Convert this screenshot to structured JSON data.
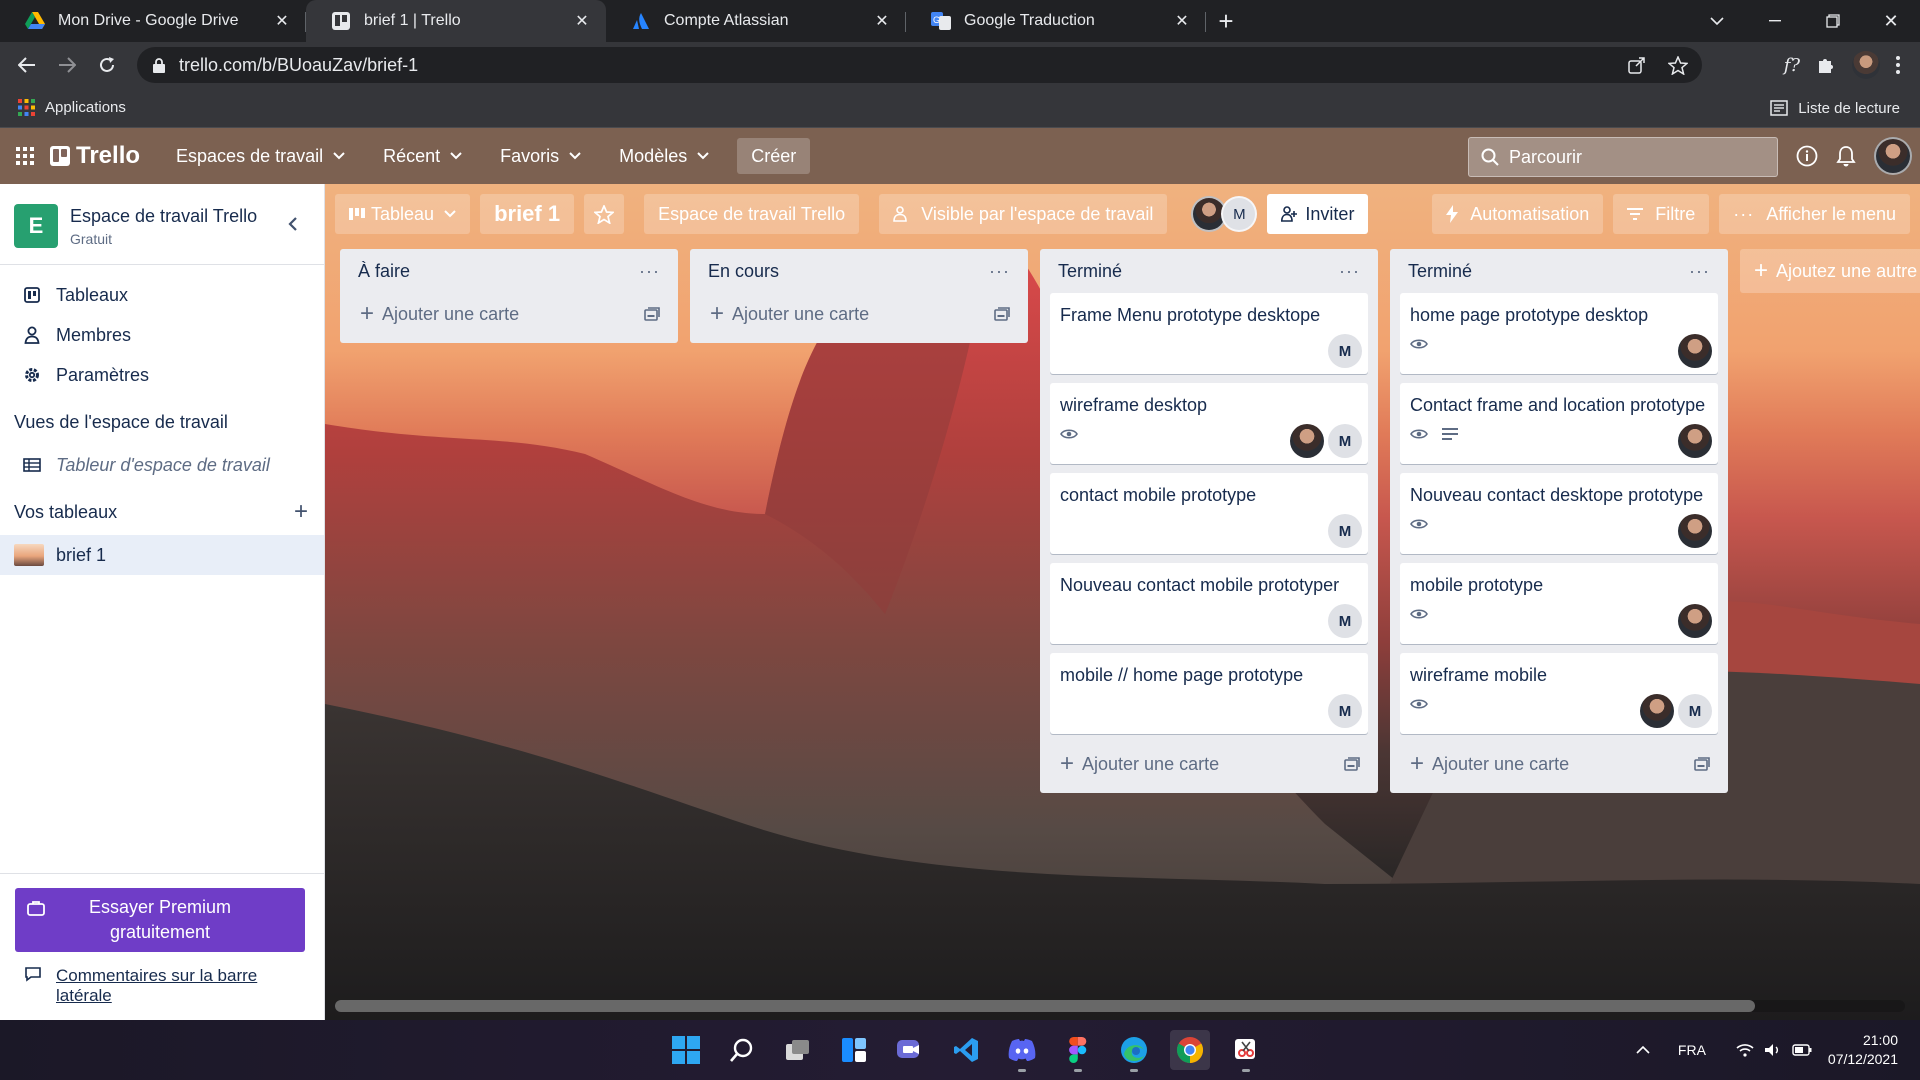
{
  "browser": {
    "tabs": [
      {
        "title": "Mon Drive - Google Drive",
        "icon": "google-drive-icon",
        "active": false
      },
      {
        "title": "brief 1 | Trello",
        "icon": "trello-icon",
        "active": true
      },
      {
        "title": "Compte Atlassian",
        "icon": "atlassian-icon",
        "active": false
      },
      {
        "title": "Google Traduction",
        "icon": "google-translate-icon",
        "active": false
      }
    ],
    "url": "trello.com/b/BUoauZav/brief-1",
    "bookmarks": {
      "apps": "Applications",
      "reading_list": "Liste de lecture"
    }
  },
  "header": {
    "logo": "Trello",
    "nav": [
      {
        "label": "Espaces de travail"
      },
      {
        "label": "Récent"
      },
      {
        "label": "Favoris"
      },
      {
        "label": "Modèles"
      }
    ],
    "create": "Créer",
    "search_placeholder": "Parcourir"
  },
  "sidebar": {
    "workspace_initial": "E",
    "workspace_name": "Espace de travail Trello",
    "workspace_plan": "Gratuit",
    "items": [
      {
        "label": "Tableaux",
        "icon": "board-icon"
      },
      {
        "label": "Membres",
        "icon": "person-icon"
      },
      {
        "label": "Paramètres",
        "icon": "gear-icon"
      }
    ],
    "views_heading": "Vues de l'espace de travail",
    "views_item": "Tableur d'espace de travail",
    "boards_heading": "Vos tableaux",
    "boards": [
      {
        "label": "brief 1"
      }
    ],
    "premium": "Essayer Premium gratuitement",
    "feedback": "Commentaires sur la barre latérale"
  },
  "boardbar": {
    "view": "Tableau",
    "name": "brief 1",
    "workspace": "Espace de travail Trello",
    "visibility": "Visible par l'espace de travail",
    "member_initial": "M",
    "invite": "Inviter",
    "automation": "Automatisation",
    "filter": "Filtre",
    "menu": "Afficher le menu"
  },
  "lists": [
    {
      "title": "À faire",
      "add": "Ajouter une carte",
      "cards": []
    },
    {
      "title": "En cours",
      "add": "Ajouter une carte",
      "cards": []
    },
    {
      "title": "Terminé",
      "add": "Ajouter une carte",
      "cards": [
        {
          "title": "Frame Menu prototype desktope",
          "badges": [],
          "members": [
            "M"
          ]
        },
        {
          "title": "wireframe desktop",
          "badges": [
            "eye-icon"
          ],
          "members": [
            "photo",
            "M"
          ]
        },
        {
          "title": "contact mobile prototype",
          "badges": [],
          "members": [
            "M"
          ]
        },
        {
          "title": "Nouveau contact mobile prototyper",
          "badges": [],
          "members": [
            "M"
          ]
        },
        {
          "title": "mobile // home page prototype",
          "badges": [],
          "members": [
            "M"
          ]
        }
      ]
    },
    {
      "title": "Terminé",
      "add": "Ajouter une carte",
      "cards": [
        {
          "title": "home page prototype desktop",
          "badges": [
            "eye-icon"
          ],
          "members": [
            "photo"
          ]
        },
        {
          "title": "Contact frame and location prototype",
          "badges": [
            "eye-icon",
            "description-icon"
          ],
          "members": [
            "photo"
          ]
        },
        {
          "title": "Nouveau contact desktope prototype",
          "badges": [
            "eye-icon"
          ],
          "members": [
            "photo"
          ]
        },
        {
          "title": "mobile prototype",
          "badges": [
            "eye-icon"
          ],
          "members": [
            "photo"
          ]
        },
        {
          "title": "wireframe mobile",
          "badges": [
            "eye-icon"
          ],
          "members": [
            "photo",
            "M"
          ]
        }
      ]
    }
  ],
  "add_list": "Ajoutez une autre liste",
  "taskbar": {
    "apps": [
      "windows-start-icon",
      "search-icon",
      "task-view-icon",
      "widgets-icon",
      "teams-chat-icon",
      "vscode-icon",
      "discord-icon",
      "figma-icon",
      "edge-icon",
      "chrome-icon",
      "snipping-tool-icon"
    ],
    "language": "FRA",
    "time": "21:00",
    "date": "07/12/2021"
  }
}
